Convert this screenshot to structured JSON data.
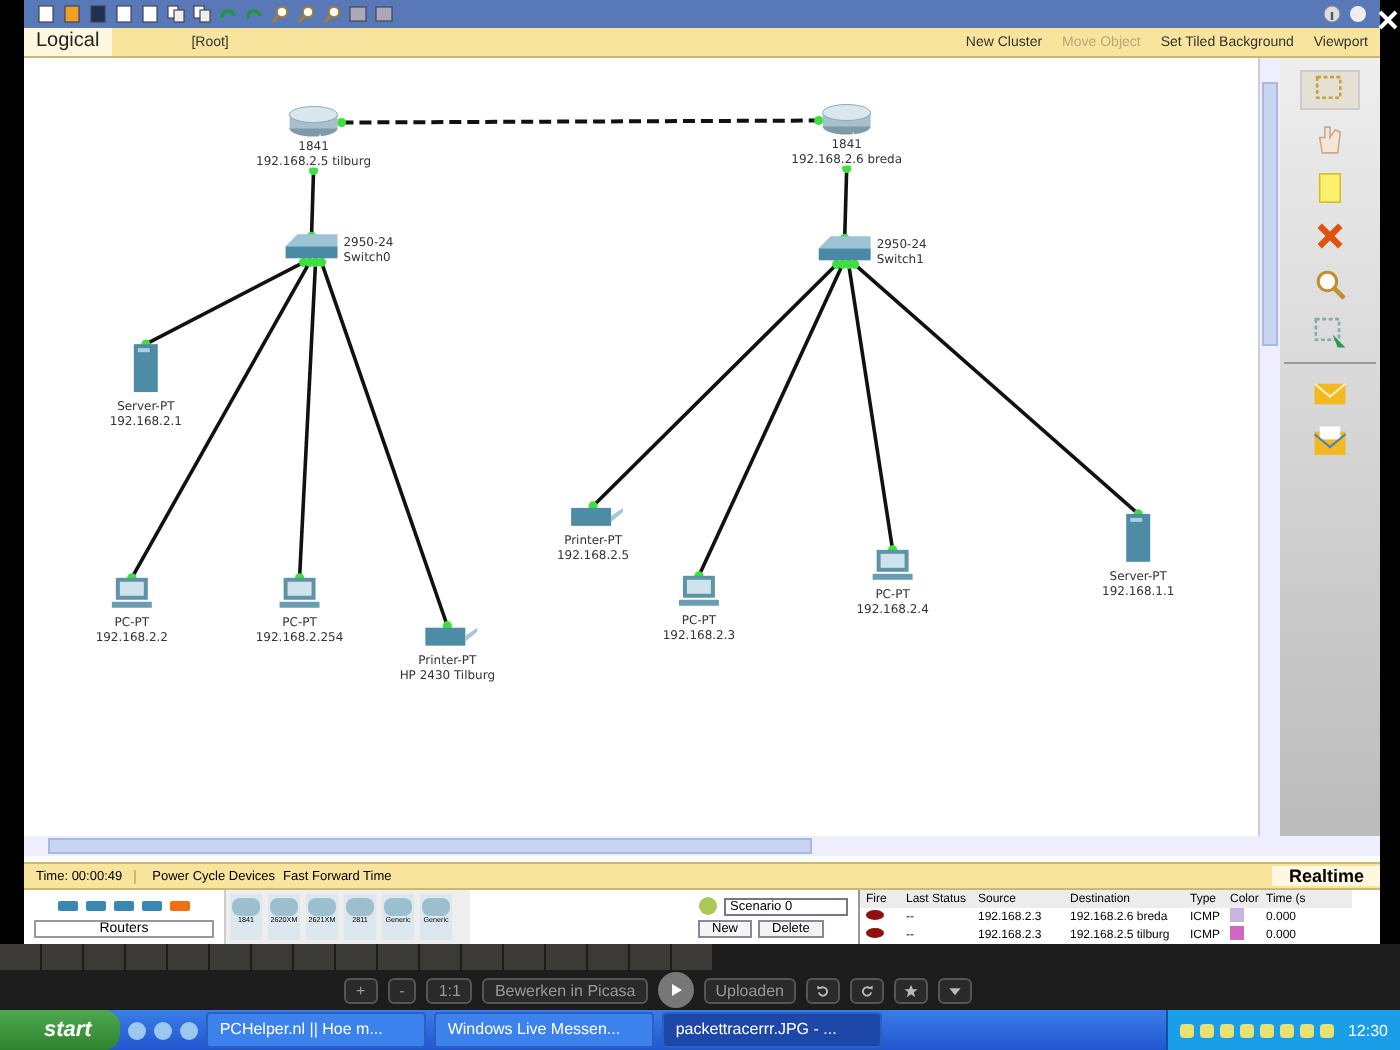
{
  "logical_bar": {
    "tab": "Logical",
    "path": "[Root]",
    "actions": [
      {
        "label": "New Cluster",
        "disabled": false
      },
      {
        "label": "Move Object",
        "disabled": true
      },
      {
        "label": "Set Tiled Background",
        "disabled": false
      },
      {
        "label": "Viewport",
        "disabled": false
      }
    ]
  },
  "sites": [
    {
      "router": {
        "labels": [
          "1841",
          "192.168.2.5 tilburg"
        ]
      },
      "switch": {
        "labels": [
          "2950-24",
          "Switch0"
        ]
      },
      "devices": [
        {
          "kind": "server",
          "labels": [
            "Server-PT",
            "192.168.2.1"
          ]
        },
        {
          "kind": "pc",
          "labels": [
            "PC-PT",
            "192.168.2.2"
          ]
        },
        {
          "kind": "pc",
          "labels": [
            "PC-PT",
            "192.168.2.254"
          ]
        },
        {
          "kind": "printer",
          "labels": [
            "Printer-PT",
            "HP 2430 Tilburg"
          ]
        }
      ]
    },
    {
      "router": {
        "labels": [
          "1841",
          "192.168.2.6 breda"
        ]
      },
      "switch": {
        "labels": [
          "2950-24",
          "Switch1"
        ]
      },
      "devices": [
        {
          "kind": "printer",
          "labels": [
            "Printer-PT",
            "192.168.2.5"
          ]
        },
        {
          "kind": "pc",
          "labels": [
            "PC-PT",
            "192.168.2.3"
          ]
        },
        {
          "kind": "pc",
          "labels": [
            "PC-PT",
            "192.168.2.4"
          ]
        },
        {
          "kind": "server",
          "labels": [
            "Server-PT",
            "192.168.1.1"
          ]
        }
      ]
    }
  ],
  "time_bar": {
    "time": "Time: 00:00:49",
    "actions": [
      "Power Cycle Devices",
      "Fast Forward Time"
    ],
    "mode": "Realtime"
  },
  "device_panel": {
    "category": "Routers",
    "models": [
      "1841",
      "2620XM",
      "2621XM",
      "2811",
      "Generic",
      "Generic"
    ]
  },
  "scenario": {
    "value": "Scenario 0",
    "buttons": [
      "New",
      "Delete"
    ]
  },
  "pdu_table": {
    "columns": [
      "Fire",
      "Last Status",
      "Source",
      "Destination",
      "Type",
      "Color",
      "Time (s"
    ],
    "rows": [
      {
        "last_status": "--",
        "source": "192.168.2.3",
        "destination": "192.168.2.6 breda",
        "type": "ICMP",
        "color": "#c8b4e0",
        "time": "0.000"
      },
      {
        "last_status": "--",
        "source": "192.168.2.3",
        "destination": "192.168.2.5 tilburg",
        "type": "ICMP",
        "color": "#d068c0",
        "time": "0.000"
      }
    ]
  },
  "picasa_bar": {
    "buttons": [
      "+",
      "-",
      "1:1",
      "Bewerken in Picasa",
      "Uploaden"
    ]
  },
  "taskbar": {
    "start": "start",
    "tasks": [
      {
        "label": "PCHelper.nl || Hoe m...",
        "selected": false
      },
      {
        "label": "Windows Live Messen...",
        "selected": false
      },
      {
        "label": "packettracerrr.JPG - ...",
        "selected": true
      }
    ],
    "clock": "12:30"
  }
}
